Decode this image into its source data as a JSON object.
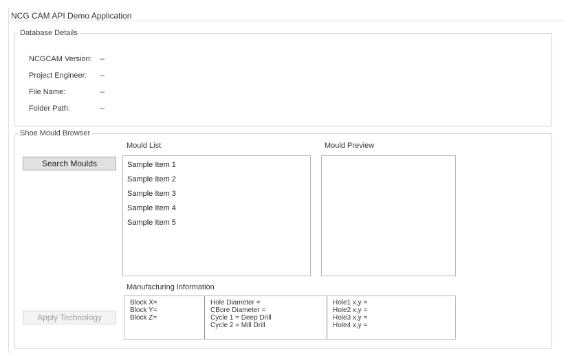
{
  "window": {
    "title": "NCG CAM API Demo Application"
  },
  "database": {
    "legend": "Database Details",
    "rows": [
      {
        "label": "NCGCAM Version:",
        "value": "--"
      },
      {
        "label": "Project Engineer:",
        "value": "--"
      },
      {
        "label": "File Name:",
        "value": "--"
      },
      {
        "label": "Folder Path:",
        "value": "--"
      }
    ]
  },
  "browser": {
    "legend": "Shoe Mould Browser",
    "search_label": "Search Moulds",
    "apply_label": "Apply Technology",
    "mould_list_label": "Mould List",
    "mould_preview_label": "Mould Preview",
    "items": [
      "Sample Item 1",
      "Sample Item 2",
      "Sample Item 3",
      "Sample Item 4",
      "Sample Item 5"
    ],
    "mfg": {
      "label": "Manufacturing Information",
      "col1": [
        "Block X=",
        "Block Y=",
        "Block Z="
      ],
      "col2": [
        "Hole Diameter  =",
        "CBore Diameter =",
        "Cycle 1 = Deep Drill",
        "Cycle 2 = Mill Drill"
      ],
      "col3": [
        "Hole1 x,y =",
        "Hole2 x,y =",
        "Hole3 x,y =",
        "Hole4 x,y ="
      ]
    }
  }
}
